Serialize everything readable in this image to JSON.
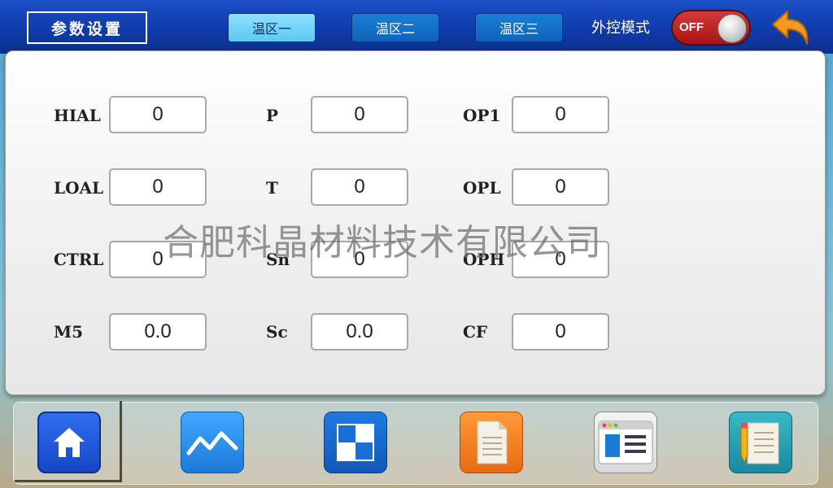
{
  "header": {
    "title": "参数设置",
    "tabs": [
      {
        "label": "温区一",
        "active": true
      },
      {
        "label": "温区二",
        "active": false
      },
      {
        "label": "温区三",
        "active": false
      }
    ],
    "external_mode_label": "外控模式",
    "toggle_state": "OFF",
    "back_icon": "back-arrow-icon"
  },
  "params": {
    "HIAL": {
      "label": "HIAL",
      "value": "0"
    },
    "LOAL": {
      "label": "LOAL",
      "value": "0"
    },
    "CTRL": {
      "label": "CTRL",
      "value": "0"
    },
    "M5": {
      "label": "M5",
      "value": "0.0"
    },
    "P": {
      "label": "P",
      "value": "0"
    },
    "T": {
      "label": "T",
      "value": "0"
    },
    "Sn": {
      "label": "Sn",
      "value": "0"
    },
    "Sc": {
      "label": "Sc",
      "value": "0.0"
    },
    "OP1": {
      "label": "OP1",
      "value": "0"
    },
    "OPL": {
      "label": "OPL",
      "value": "0"
    },
    "OPH": {
      "label": "OPH",
      "value": "0"
    },
    "CF": {
      "label": "CF",
      "value": "0"
    }
  },
  "watermark": "合肥科晶材料技术有限公司",
  "bottom_nav": [
    {
      "icon": "home-icon",
      "selected": true
    },
    {
      "icon": "trend-chart-icon",
      "selected": false
    },
    {
      "icon": "grid-squares-icon",
      "selected": false
    },
    {
      "icon": "document-icon",
      "selected": false
    },
    {
      "icon": "window-list-icon",
      "selected": false
    },
    {
      "icon": "edit-document-icon",
      "selected": false
    }
  ],
  "colors": {
    "header_bg": "#0f3aa8",
    "tab_active": "#5ccaf2",
    "tab_inactive": "#0f63b8",
    "toggle_off": "#c02020"
  }
}
